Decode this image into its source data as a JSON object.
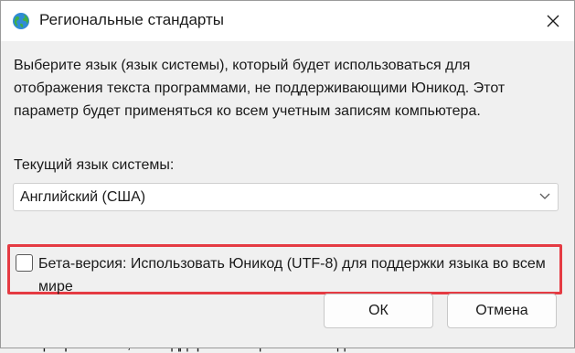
{
  "window": {
    "title": "Региональные стандарты",
    "icon": "globe-icon",
    "close_icon": "close-icon"
  },
  "description": "Выберите язык (язык системы), который будет использоваться для отображения текста программами, не поддерживающими Юникод. Этот параметр будет применяться ко всем учетным записям компьютера.",
  "system_language": {
    "label": "Текущий язык системы:",
    "selected": "Английский (США)"
  },
  "beta_option": {
    "label": "Бета-версия: Использовать Юникод (UTF-8) для поддержки языка во всем мире",
    "checked": false,
    "highlight_color": "#e53b43"
  },
  "buttons": {
    "ok": "ОК",
    "cancel": "Отмена"
  },
  "background_text": "программами, не поддерживающими Юникод."
}
